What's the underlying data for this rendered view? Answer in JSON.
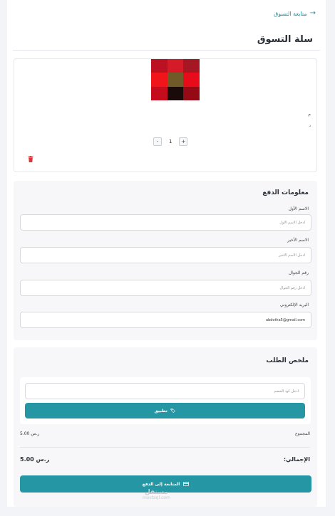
{
  "header": {
    "back_label": "متابعة التسوق",
    "page_title": "سلة التسوق"
  },
  "cart": {
    "thumbnail_colors": [
      "#9c1a26",
      "#c81f2a",
      "#b01424",
      "#d8101e",
      "#6e5a2c",
      "#e0181f",
      "#8b0d17",
      "#1a0a0a",
      "#b8101e"
    ],
    "item_text_1": "م",
    "item_text_2": "د",
    "quantity": "1",
    "minus_label": "-",
    "plus_label": "+"
  },
  "payment": {
    "title": "معلومات الدفع",
    "first_name": {
      "label": "الاسم الأول",
      "placeholder": "أدخل الاسم الأول",
      "value": ""
    },
    "last_name": {
      "label": "الاسم الأخير",
      "placeholder": "أدخل الاسم الأخير",
      "value": ""
    },
    "phone": {
      "label": "رقم الجوال",
      "placeholder": "أدخل رقم الجوال",
      "value": ""
    },
    "email": {
      "label": "البريد الإلكتروني",
      "placeholder": "",
      "value": "abdotha5@gmail.com"
    }
  },
  "summary": {
    "title": "ملخص الطلب",
    "coupon_placeholder": "أدخل كود الخصم",
    "apply_label": "تطبيق",
    "subtotal_label": "المجموع",
    "subtotal_value": "5.00 ر.س",
    "total_label": "الإجمالي:",
    "total_value": "5.00 ر.س",
    "checkout_label": "المتابعة إلى الدفع"
  },
  "watermark": {
    "arabic": "مستقل",
    "latin": "mostaql.com"
  },
  "colors": {
    "accent": "#2596a3",
    "link": "#2a8f9c",
    "danger": "#d9363e"
  }
}
